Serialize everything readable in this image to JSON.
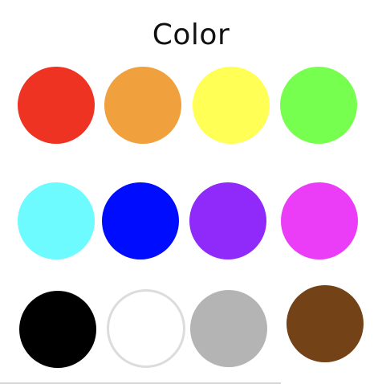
{
  "title": "Color",
  "swatches": [
    {
      "name": "red",
      "color": "#EE3322"
    },
    {
      "name": "orange",
      "color": "#F0A03C"
    },
    {
      "name": "yellow",
      "color": "#FFFF55"
    },
    {
      "name": "green",
      "color": "#77FF4F"
    },
    {
      "name": "cyan",
      "color": "#6EFBFF"
    },
    {
      "name": "blue",
      "color": "#000CFE"
    },
    {
      "name": "purple",
      "color": "#8F2AFA"
    },
    {
      "name": "magenta",
      "color": "#EB3DF7"
    },
    {
      "name": "black",
      "color": "#000000"
    },
    {
      "name": "white",
      "color": "#FFFFFF"
    },
    {
      "name": "gray",
      "color": "#B4B4B4"
    },
    {
      "name": "brown",
      "color": "#734217"
    }
  ]
}
